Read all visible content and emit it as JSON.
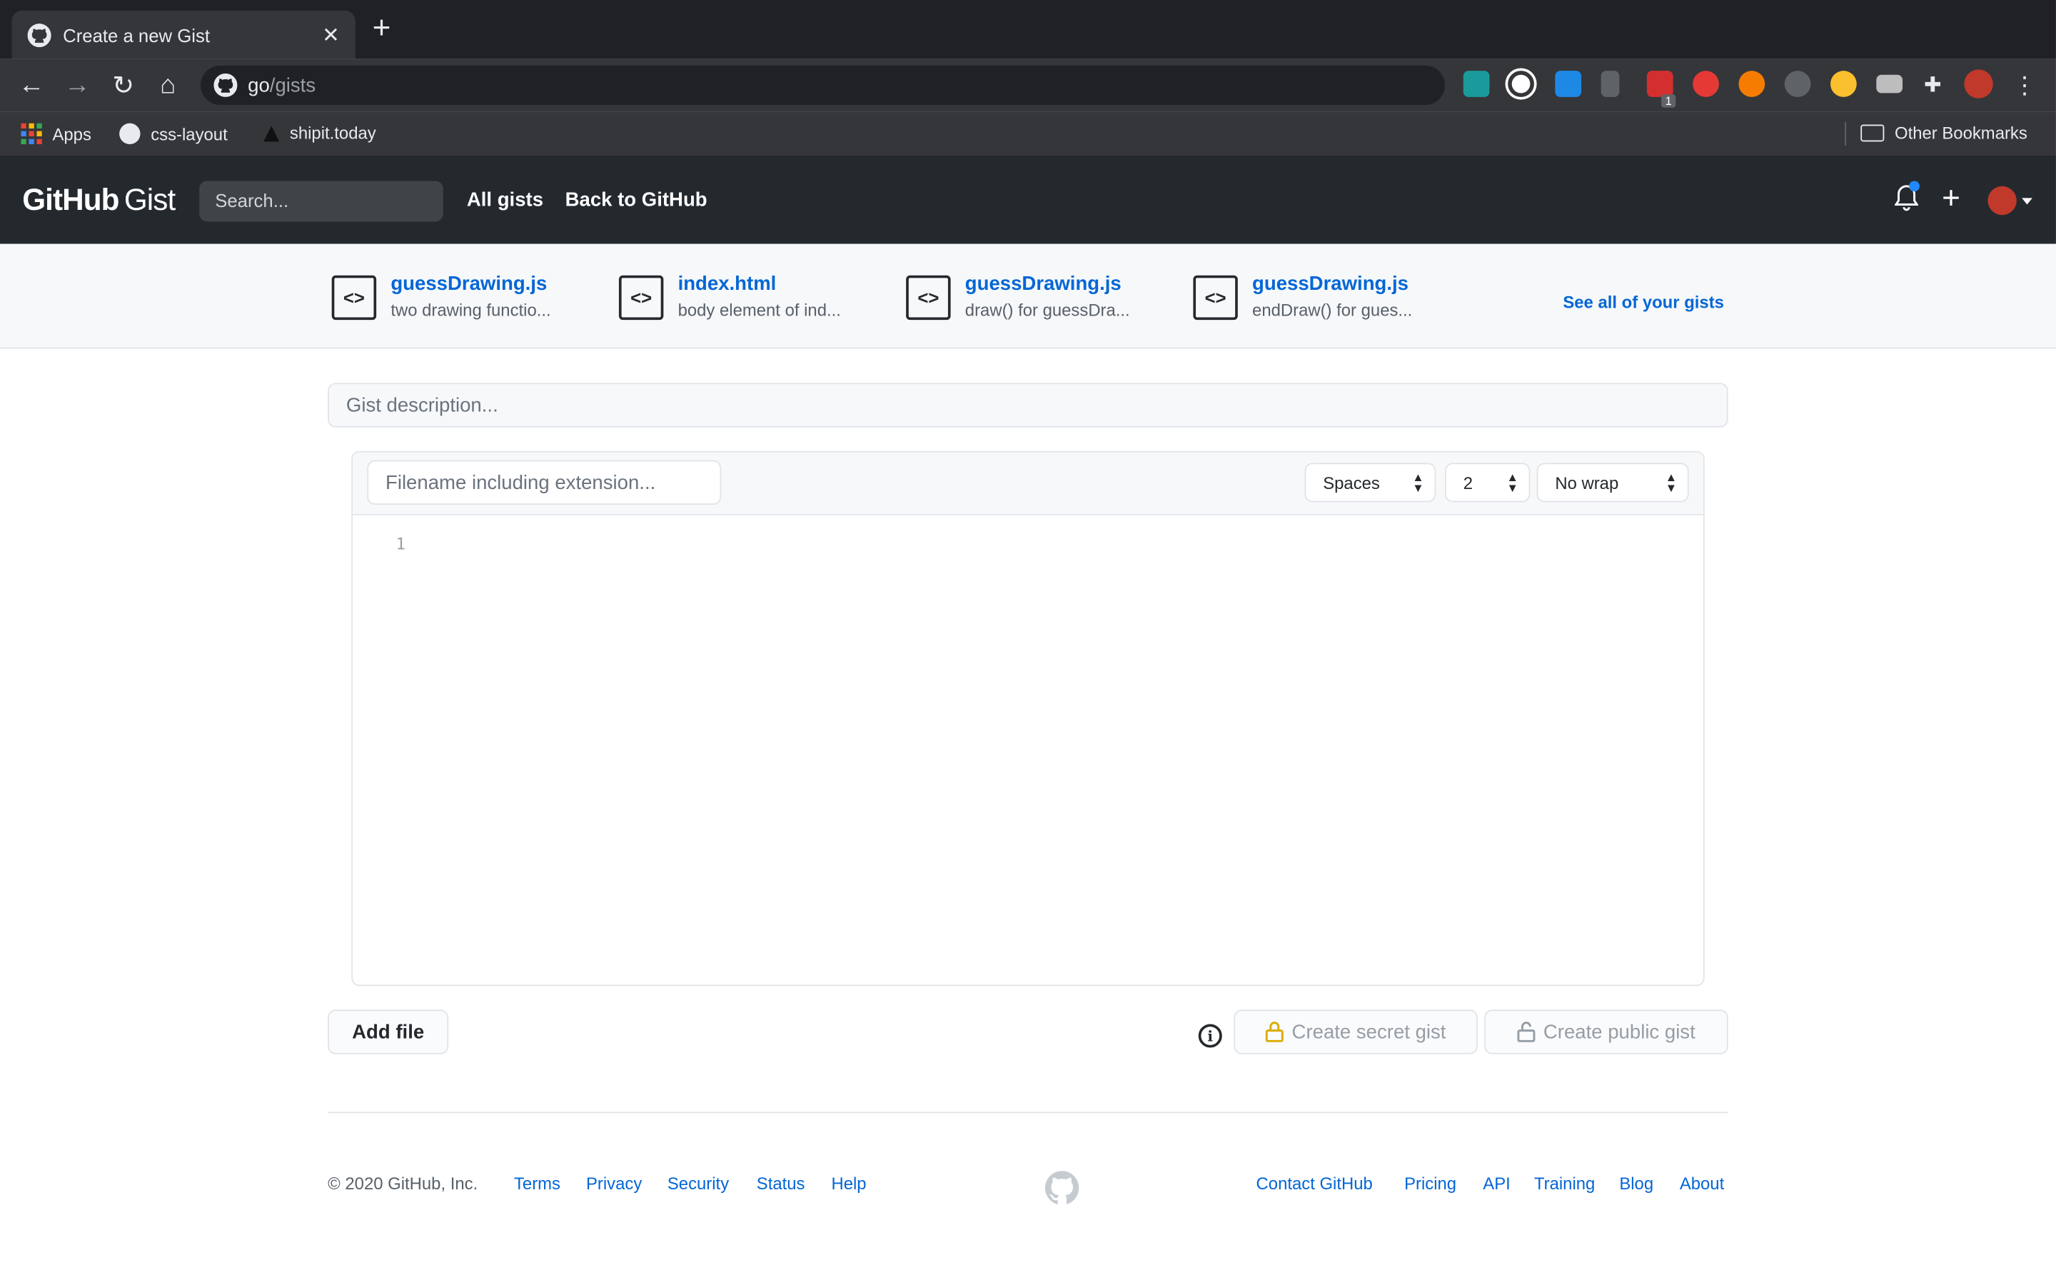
{
  "browser": {
    "tab_title": "Create a new Gist",
    "url_host": "go",
    "url_path": "/gists",
    "bookmarks": [
      "Apps",
      "css-layout",
      "shipit.today"
    ],
    "other_bookmarks": "Other Bookmarks",
    "ext_badge": "1"
  },
  "header": {
    "logo_main": "GitHub",
    "logo_sub": "Gist",
    "search_placeholder": "Search...",
    "nav": [
      "All gists",
      "Back to GitHub"
    ]
  },
  "recent_gists": [
    {
      "name": "guessDrawing.js",
      "desc": "two drawing functio..."
    },
    {
      "name": "index.html",
      "desc": "body element of ind..."
    },
    {
      "name": "guessDrawing.js",
      "desc": "draw() for guessDra..."
    },
    {
      "name": "guessDrawing.js",
      "desc": "endDraw() for gues..."
    }
  ],
  "see_all": "See all of your gists",
  "form": {
    "description_placeholder": "Gist description...",
    "filename_placeholder": "Filename including extension...",
    "indent_mode": "Spaces",
    "indent_size": "2",
    "wrap_mode": "No wrap",
    "line_number": "1",
    "add_file": "Add file",
    "create_secret": "Create secret gist",
    "create_public": "Create public gist",
    "info_glyph": "i"
  },
  "footer": {
    "copyright": "© 2020 GitHub, Inc.",
    "left_links": [
      "Terms",
      "Privacy",
      "Security",
      "Status",
      "Help"
    ],
    "right_links": [
      "Contact GitHub",
      "Pricing",
      "API",
      "Training",
      "Blog",
      "About"
    ]
  },
  "colors": {
    "header_bg": "#24292e",
    "link": "#0366d6",
    "chrome_dark": "#202124",
    "chrome_mid": "#35363a"
  }
}
